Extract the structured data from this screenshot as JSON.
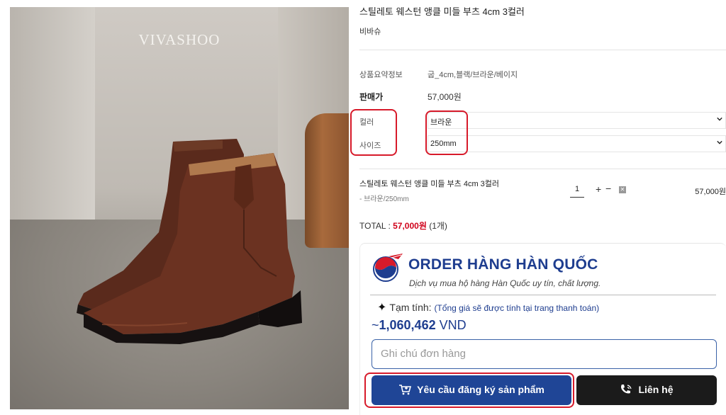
{
  "photo": {
    "brand_watermark": "VIVASHOO"
  },
  "product": {
    "title": "스틸레토 웨스턴 앵클 미들 부츠 4cm 3컬러",
    "brand": "비바슈",
    "summary_label": "상품요약정보",
    "summary_value": "굽_4cm,블랙/브라운/베이지",
    "price_label": "판매가",
    "price_value": "57,000원"
  },
  "options": {
    "color_label": "컬러",
    "color_value": "브라운",
    "size_label": "사이즈",
    "size_value": "250mm"
  },
  "selected_item": {
    "name": "스틸레토 웨스턴 앵클 미들 부츠 4cm 3컬러",
    "option": "- 브라운/250mm",
    "quantity": "1",
    "plus": "+",
    "minus": "−",
    "delete": "✕",
    "price": "57,000원"
  },
  "total": {
    "label": "TOTAL : ",
    "amount": "57,000원",
    "count": " (1개)"
  },
  "order": {
    "title": "ORDER HÀNG HÀN QUỐC",
    "subtitle": "Dịch vụ mua hộ hàng Hàn Quốc uy tín, chất lượng.",
    "estimate_label": "Tạm tính:",
    "estimate_note": "(Tổng giá sẽ được tính tại trang thanh toán)",
    "tilde": "~",
    "vnd_amount": "1,060,462",
    "vnd_currency": "VND",
    "note_placeholder": "Ghi chú đơn hàng",
    "order_button": "Yêu cầu đăng ký sản phẩm",
    "contact_button": "Liên hệ"
  },
  "colors": {
    "highlight": "#d71a2a",
    "primary_blue": "#1f4596",
    "price_red": "#d0021b"
  }
}
